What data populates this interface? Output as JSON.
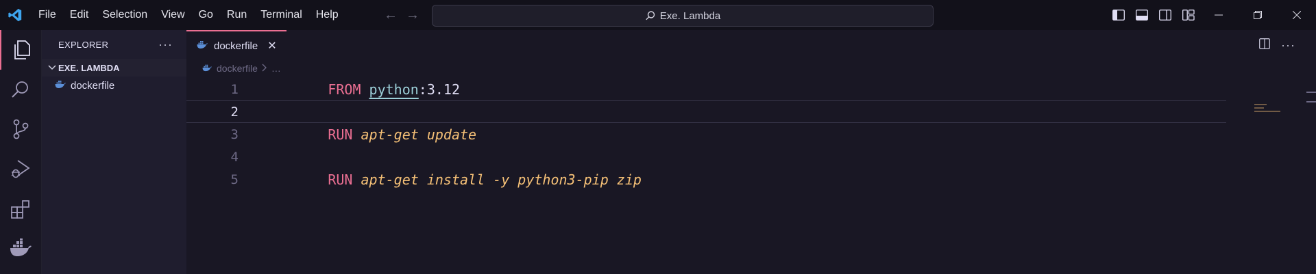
{
  "menu": [
    "File",
    "Edit",
    "Selection",
    "View",
    "Go",
    "Run",
    "Terminal",
    "Help"
  ],
  "command_center": {
    "text": "Exe. Lambda"
  },
  "sidebar": {
    "title": "EXPLORER",
    "more": "···",
    "folder": "EXE. LAMBDA",
    "files": [
      "dockerfile"
    ]
  },
  "tab": {
    "label": "dockerfile",
    "close": "✕"
  },
  "breadcrumbs": {
    "file": "dockerfile",
    "more": "…"
  },
  "editor_more": "···",
  "code": {
    "line_numbers": [
      "1",
      "2",
      "3",
      "4",
      "5"
    ],
    "line1": {
      "keyword": "FROM",
      "image": "python",
      "tag": ":3.12"
    },
    "line3": {
      "keyword": "RUN",
      "command": "apt-get update"
    },
    "line5": {
      "keyword": "RUN",
      "command": "apt-get install -y python3-pip zip"
    }
  },
  "colors": {
    "accent": "#eb6f92",
    "keyword": "#eb6f92",
    "image": "#9ccfd8",
    "command": "#f6c177",
    "background": "#191724"
  },
  "icons": [
    "vscode-logo-icon",
    "files-icon",
    "search-icon",
    "source-control-icon",
    "run-debug-icon",
    "extensions-icon",
    "docker-icon"
  ]
}
